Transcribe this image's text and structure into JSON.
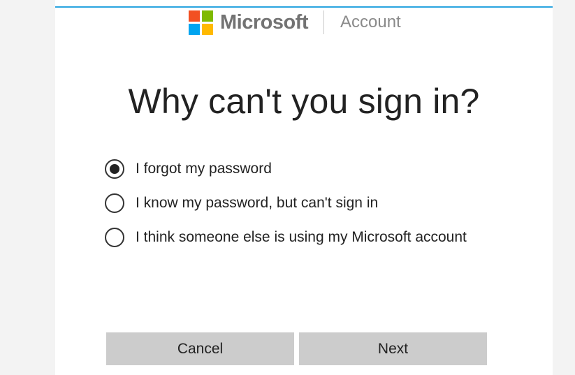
{
  "header": {
    "brand": "Microsoft",
    "section": "Account",
    "logo_colors": [
      "#f25022",
      "#7fba00",
      "#00a4ef",
      "#ffb900"
    ]
  },
  "main": {
    "title": "Why can't you sign in?",
    "options": [
      {
        "label": "I forgot my password",
        "selected": true
      },
      {
        "label": "I know my password, but can't sign in",
        "selected": false
      },
      {
        "label": "I think someone else is using my Microsoft account",
        "selected": false
      }
    ]
  },
  "buttons": {
    "cancel": "Cancel",
    "next": "Next"
  },
  "colors": {
    "accent_rule": "#2aa4e0",
    "button_bg": "#cccccc"
  }
}
